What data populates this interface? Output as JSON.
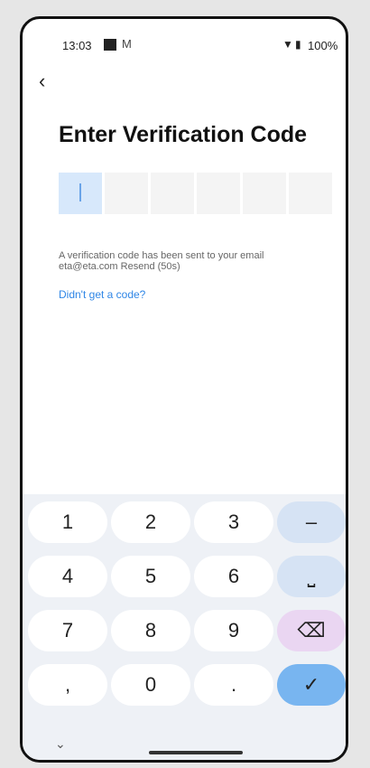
{
  "status_bar": {
    "time": "13:03",
    "mail_icon": "M",
    "battery_percent": "100%"
  },
  "screen": {
    "title": "Enter Verification Code",
    "code_placeholder": "",
    "info_text": "A verification code has been sent to your email eta@eta.com Resend (50s)",
    "help_link": "Didn't get a code?"
  },
  "keyboard": {
    "rows": [
      [
        "1",
        "2",
        "3",
        "–"
      ],
      [
        "4",
        "5",
        "6",
        "⎵"
      ],
      [
        "7",
        "8",
        "9",
        "⌫"
      ],
      [
        ",",
        "0",
        ".",
        "✓"
      ]
    ],
    "chevron": "⌄"
  }
}
